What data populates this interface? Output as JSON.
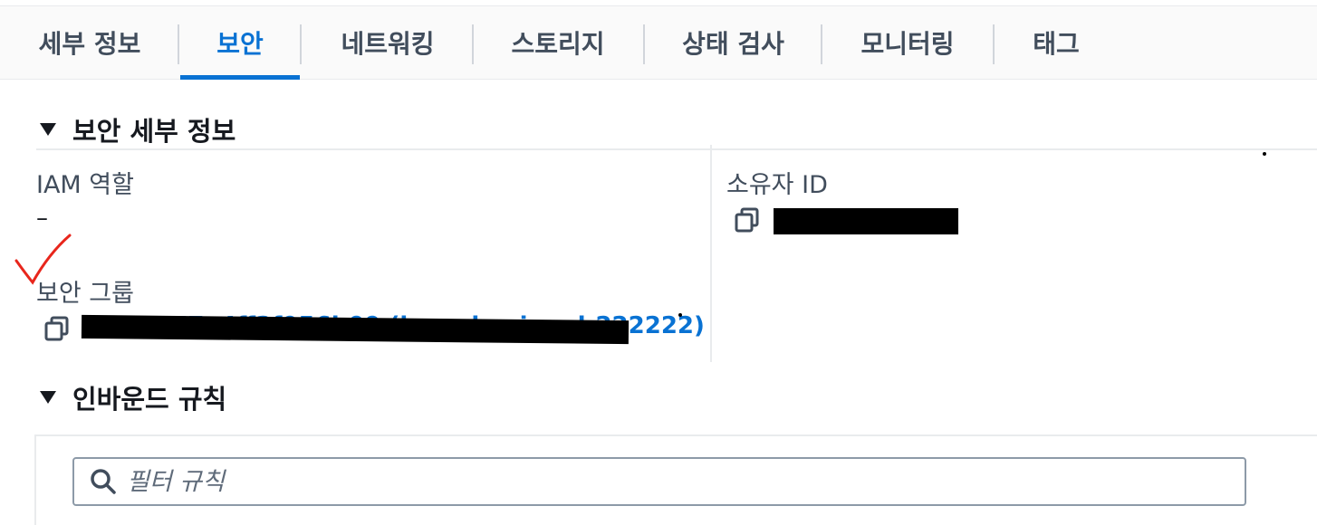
{
  "tabs": [
    {
      "label": "세부 정보"
    },
    {
      "label": "보안"
    },
    {
      "label": "네트워킹"
    },
    {
      "label": "스토리지"
    },
    {
      "label": "상태 검사"
    },
    {
      "label": "모니터링"
    },
    {
      "label": "태그"
    }
  ],
  "active_tab": "보안",
  "security_details": {
    "title": "보안 세부 정보",
    "iam_role_label": "IAM 역할",
    "iam_role_value": "–",
    "security_groups_label": "보안 그룹",
    "security_group_link": "sg-05177a4ff3f956b09 (launch-wizard-222222)",
    "owner_id_label": "소유자 ID"
  },
  "inbound_rules": {
    "title": "인바운드 규칙",
    "filter_placeholder": "필터 규칙"
  },
  "icons": [
    "caret-down-icon",
    "copy-icon",
    "search-icon"
  ],
  "colors": {
    "accent": "#0972d3",
    "annotation": "#e8261c"
  }
}
